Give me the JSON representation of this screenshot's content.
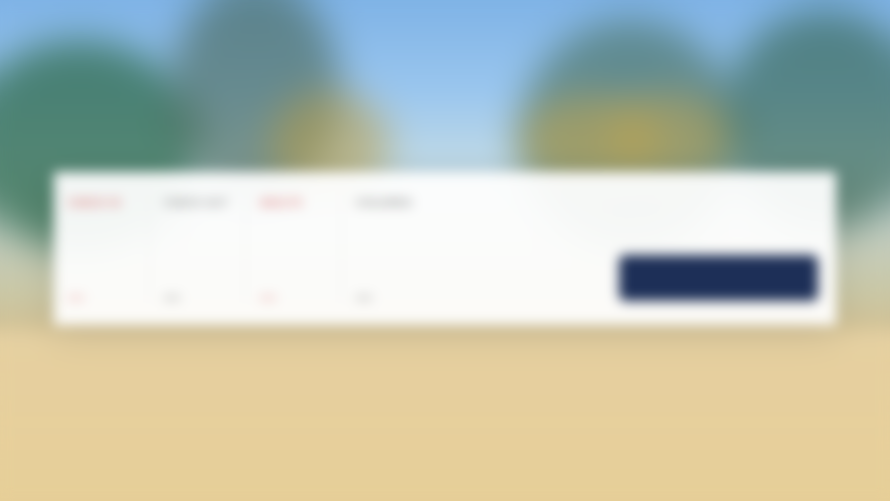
{
  "booking": {
    "fields": [
      {
        "label": "Check In",
        "value": "—"
      },
      {
        "label": "Check Out",
        "value": "—"
      },
      {
        "label": "Adults",
        "value": "—"
      },
      {
        "label": "Children",
        "value": "—"
      }
    ],
    "cta": {
      "note": "",
      "button_label": ""
    }
  },
  "colors": {
    "accent": "#c62828",
    "button": "#1d2f57",
    "panel": "#ffffff"
  }
}
